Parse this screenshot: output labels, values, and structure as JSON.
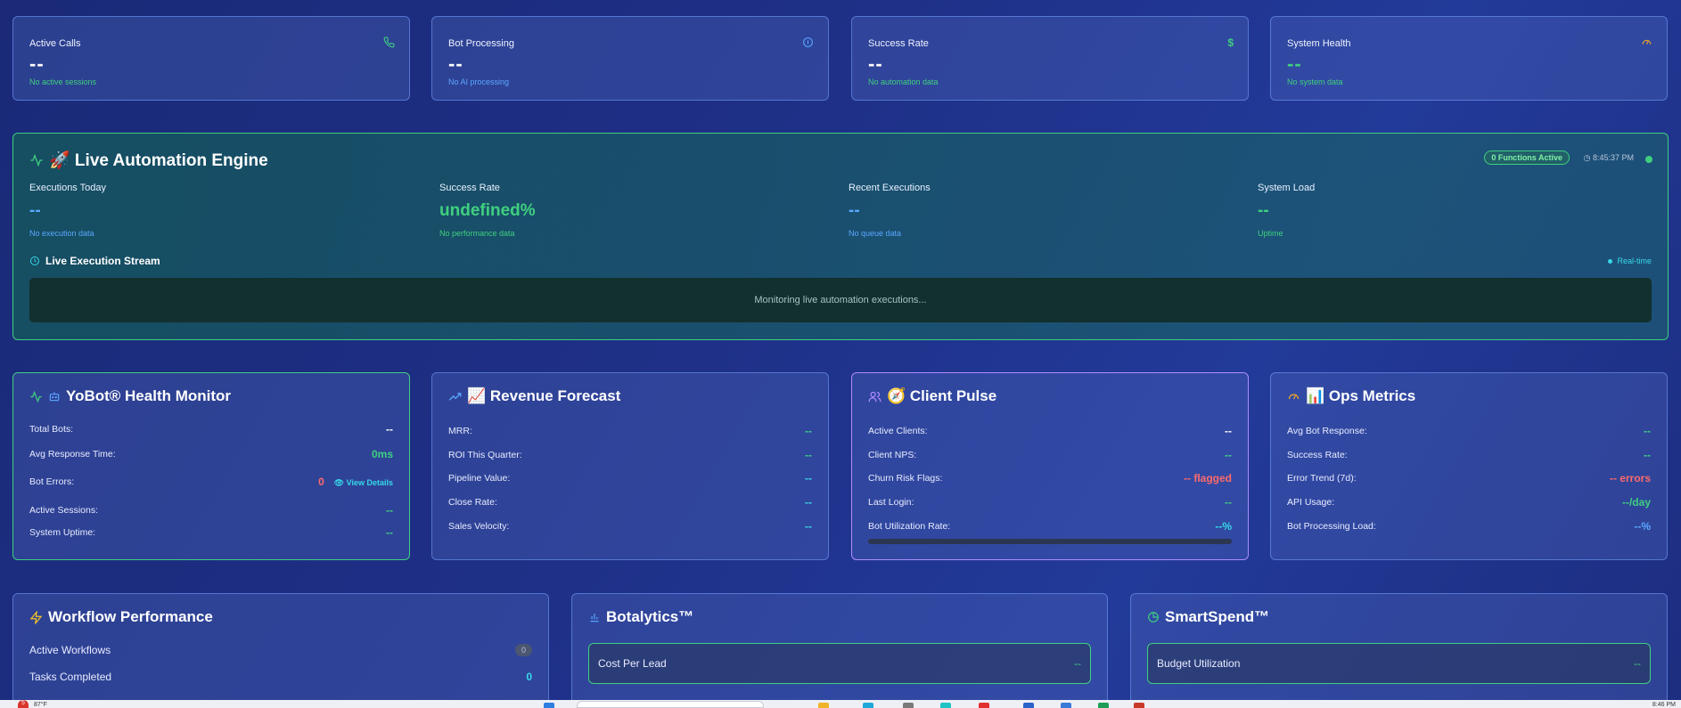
{
  "stats": [
    {
      "label": "Active Calls",
      "value": "--",
      "sub": "No active sessions",
      "icon": "phone-icon",
      "icon_color": "#3fd07f",
      "sub_color": "#3fd07f"
    },
    {
      "label": "Bot Processing",
      "value": "--",
      "sub": "No AI processing",
      "icon": "info-icon",
      "icon_color": "#5aa8ff",
      "sub_color": "#5aa8ff"
    },
    {
      "label": "Success Rate",
      "value": "--",
      "sub": "No automation data",
      "icon": "dollar-icon",
      "icon_color": "#3fd07f",
      "sub_color": "#3fd07f"
    },
    {
      "label": "System Health",
      "value": "--",
      "sub": "No system data",
      "icon": "gauge-icon",
      "icon_color": "#f5a623",
      "sub_color": "#3fd07f"
    }
  ],
  "engine": {
    "title": "🚀 Live Automation Engine",
    "functions_badge": "0 Functions Active",
    "time": "8:45:37 PM",
    "metrics": [
      {
        "label": "Executions Today",
        "value": "--",
        "sub": "No execution data",
        "color": "#5aa8ff"
      },
      {
        "label": "Success Rate",
        "value": "undefined%",
        "sub": "No performance data",
        "color": "#3fd07f"
      },
      {
        "label": "Recent Executions",
        "value": "--",
        "sub": "No queue data",
        "color": "#5aa8ff"
      },
      {
        "label": "System Load",
        "value": "--",
        "sub": "Uptime",
        "color": "#3fd07f"
      }
    ],
    "stream_title": "Live Execution Stream",
    "realtime": "Real-time",
    "stream_message": "Monitoring live automation executions..."
  },
  "health": {
    "title": "YoBot® Health Monitor",
    "rows": [
      {
        "label": "Total Bots:",
        "value": "--"
      },
      {
        "label": "Avg Response Time:",
        "value": "0ms"
      },
      {
        "label": "Bot Errors:",
        "value": "0"
      },
      {
        "label": "Active Sessions:",
        "value": "--"
      },
      {
        "label": "System Uptime:",
        "value": "--"
      }
    ],
    "view_details": "View Details"
  },
  "revenue": {
    "title": "📈 Revenue Forecast",
    "rows": [
      {
        "label": "MRR:",
        "value": "--"
      },
      {
        "label": "ROI This Quarter:",
        "value": "--"
      },
      {
        "label": "Pipeline Value:",
        "value": "--"
      },
      {
        "label": "Close Rate:",
        "value": "--"
      },
      {
        "label": "Sales Velocity:",
        "value": "--"
      }
    ]
  },
  "client": {
    "title": "🧭 Client Pulse",
    "rows": [
      {
        "label": "Active Clients:",
        "value": "--"
      },
      {
        "label": "Client NPS:",
        "value": "--"
      },
      {
        "label": "Churn Risk Flags:",
        "value": "-- flagged"
      },
      {
        "label": "Last Login:",
        "value": "--"
      },
      {
        "label": "Bot Utilization Rate:",
        "value": "--%"
      }
    ],
    "utilization_fraction": 0
  },
  "ops": {
    "title": "📊 Ops Metrics",
    "rows": [
      {
        "label": "Avg Bot Response:",
        "value": "--"
      },
      {
        "label": "Success Rate:",
        "value": "--"
      },
      {
        "label": "Error Trend (7d):",
        "value": "-- errors"
      },
      {
        "label": "API Usage:",
        "value": "--/day"
      },
      {
        "label": "Bot Processing Load:",
        "value": "--%"
      }
    ]
  },
  "workflow": {
    "title": "Workflow Performance",
    "rows": [
      {
        "label": "Active Workflows",
        "value": "0"
      },
      {
        "label": "Tasks Completed",
        "value": "0"
      }
    ]
  },
  "botalytics": {
    "title": "Botalytics™",
    "box_label": "Cost Per Lead",
    "box_value": "--"
  },
  "smartspend": {
    "title": "SmartSpend™",
    "box_label": "Budget Utilization",
    "box_value": "--"
  },
  "taskbar": {
    "notification_count": "5",
    "left_text": "87°F",
    "clock": "8:46 PM"
  }
}
